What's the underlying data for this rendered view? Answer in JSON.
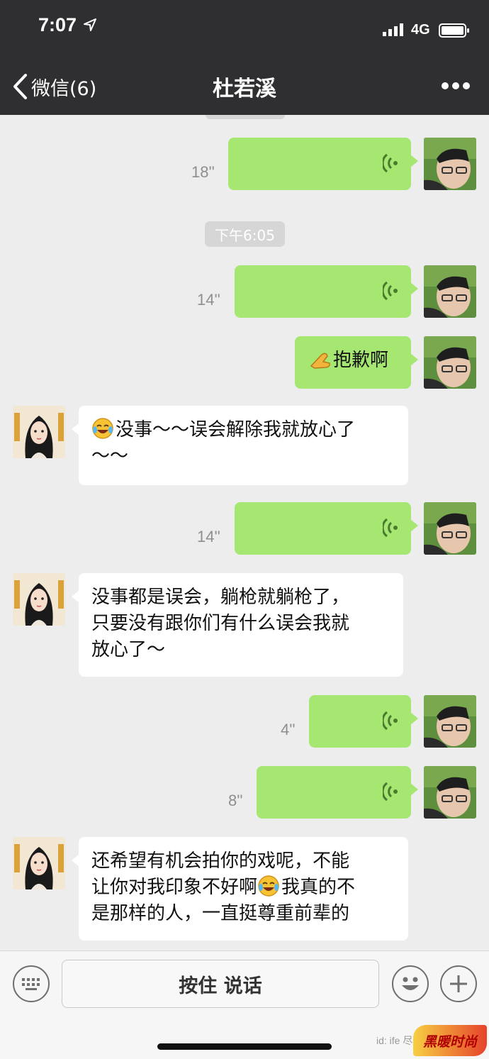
{
  "status_bar": {
    "time": "7:07",
    "network": "4G"
  },
  "nav": {
    "back_label": "微信(6)",
    "title": "杜若溪"
  },
  "timestamp": "下午6:05",
  "messages": [
    {
      "side": "me",
      "type": "voice",
      "duration": "18''"
    },
    {
      "side": "me",
      "type": "voice",
      "duration": "14''"
    },
    {
      "side": "me",
      "type": "text",
      "emoji": "hands-together-emoji",
      "text": "抱歉啊"
    },
    {
      "side": "them",
      "type": "text",
      "emoji": "laughing-crying-emoji",
      "line1": "没事～～误会解除我就放心了",
      "line2": "～～"
    },
    {
      "side": "me",
      "type": "voice",
      "duration": "14''"
    },
    {
      "side": "them",
      "type": "text",
      "line1": "没事都是误会，躺枪就躺枪了，",
      "line2": "只要没有跟你们有什么误会我就",
      "line3": "放心了～"
    },
    {
      "side": "me",
      "type": "voice",
      "duration": "4''"
    },
    {
      "side": "me",
      "type": "voice",
      "duration": "8''"
    },
    {
      "side": "them",
      "type": "text",
      "emoji": "laughing-crying-emoji",
      "line1": "还希望有机会拍你的戏呢，不能",
      "line2a": "让你对我印象不好啊",
      "line2b": "我真的不",
      "line3": "是那样的人，一直挺尊重前辈的"
    }
  ],
  "input_bar": {
    "hold_to_talk": "按住 说话"
  },
  "watermark": {
    "text": "id: ife 尽生活",
    "logo_text": "黑暖时尚"
  },
  "colors": {
    "header_bg": "#2f2f31",
    "chat_bg": "#ededed",
    "my_bubble": "#a5e770",
    "their_bubble": "#ffffff"
  }
}
